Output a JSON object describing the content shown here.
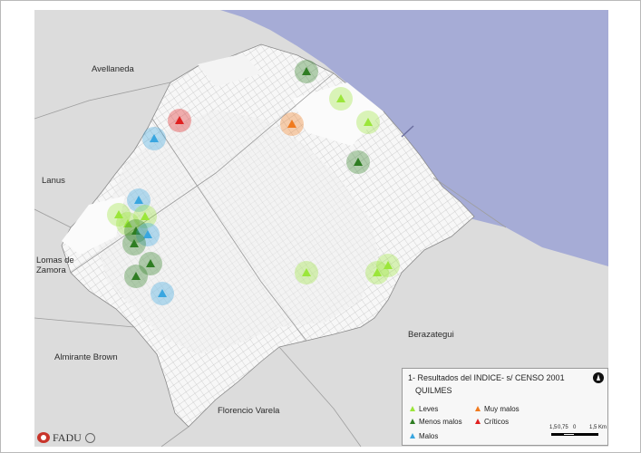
{
  "places": {
    "avellaneda": "Avellaneda",
    "lanus": "Lanus",
    "lomas_de_zamora": "Lomas de\nZamora",
    "almirante_brown": "Almirante Brown",
    "florencio_varela": "Florencio Varela",
    "berazategui": "Berazategui"
  },
  "legend": {
    "title": "1- Resultados del INDICE- s/ CENSO 2001",
    "subtitle": "QUILMES",
    "items": [
      {
        "key": "leves",
        "label": "Leves",
        "color": "#9be63a"
      },
      {
        "key": "menos_malos",
        "label": "Menos malos",
        "color": "#2f7d23"
      },
      {
        "key": "malos",
        "label": "Malos",
        "color": "#39a6e0"
      },
      {
        "key": "muy_malos",
        "label": "Muy malos",
        "color": "#f07a1e"
      },
      {
        "key": "criticos",
        "label": "Críticos",
        "color": "#e02020"
      }
    ],
    "scale": {
      "ticks": [
        "1,5",
        "0,75",
        "0",
        "1,5 Km"
      ]
    },
    "north_icon": "north-arrow-icon"
  },
  "colors": {
    "river": "#a6acd6",
    "land": "#dcdcdc",
    "district": "#f4f4f4",
    "streets": "#c9c9c9",
    "border": "#8a8a8a"
  },
  "markers": [
    {
      "category": "menos_malos"
    },
    {
      "category": "leves"
    },
    {
      "category": "leves"
    },
    {
      "category": "muy_malos"
    },
    {
      "category": "menos_malos"
    },
    {
      "category": "criticos"
    },
    {
      "category": "malos"
    },
    {
      "category": "malos"
    },
    {
      "category": "leves"
    },
    {
      "category": "leves"
    },
    {
      "category": "leves"
    },
    {
      "category": "menos_malos"
    },
    {
      "category": "malos"
    },
    {
      "category": "menos_malos"
    },
    {
      "category": "menos_malos"
    },
    {
      "category": "menos_malos"
    },
    {
      "category": "malos"
    },
    {
      "category": "leves"
    },
    {
      "category": "leves"
    },
    {
      "category": "leves"
    }
  ],
  "logo": {
    "text": "FADU"
  }
}
